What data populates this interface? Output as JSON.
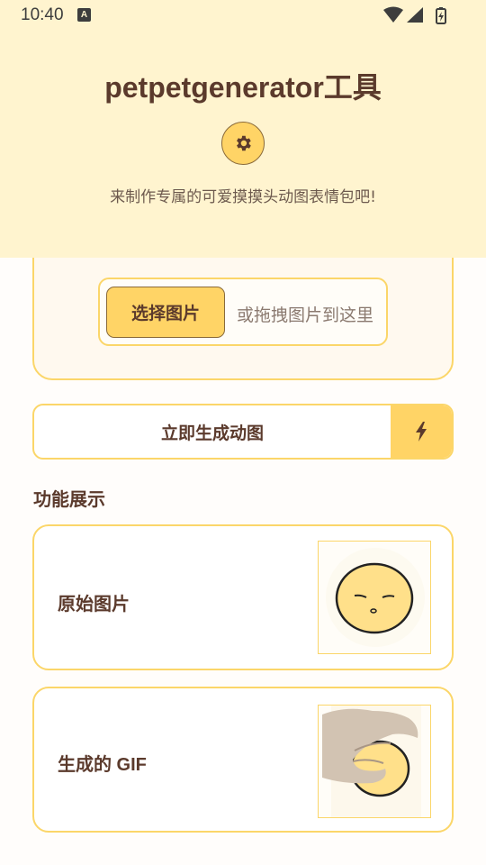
{
  "status_bar": {
    "time": "10:40",
    "notification_badge": "A",
    "icons": [
      "wifi-icon",
      "cellular-signal-icon",
      "battery-charging-icon"
    ]
  },
  "header": {
    "title": "petpetgenerator工具",
    "subtitle": "来制作专属的可爱摸摸头动图表情包吧!",
    "settings_icon": "gear-icon"
  },
  "upload": {
    "choose_button": "选择图片",
    "drag_hint": "或拖拽图片到这里"
  },
  "generate": {
    "button_label": "立即生成动图",
    "icon": "lightning-icon"
  },
  "showcase": {
    "section_title": "功能展示",
    "items": [
      {
        "label": "原始图片",
        "image": "sleepy-face-drawing"
      },
      {
        "label": "生成的 GIF",
        "image": "hand-petting-face-gif"
      }
    ]
  },
  "colors": {
    "header_bg": "#fff4cf",
    "accent": "#ffd466",
    "border": "#fbd669",
    "text_brown": "#5b3a2c"
  }
}
